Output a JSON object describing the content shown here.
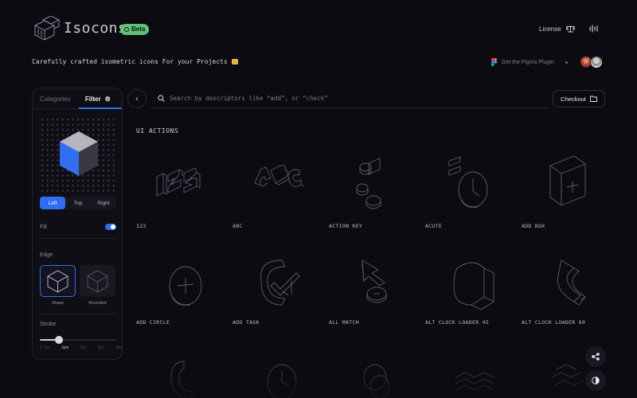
{
  "header": {
    "brand": "Isocons",
    "badge": "Beta",
    "license": "License",
    "tagline": "Carefully crafted isometric icons For your Projects",
    "figma_link": "Get the Figma Plugin"
  },
  "sidebar": {
    "tabs": [
      "Categories",
      "Filter"
    ],
    "active_tab": "Filter",
    "view_options": [
      "Left",
      "Top",
      "Right"
    ],
    "selected_view": "Left",
    "fill_label": "Fill",
    "fill_on": true,
    "edge_label": "Edge",
    "edge_options": [
      "Sharp",
      "Rounded"
    ],
    "selected_edge": "Sharp",
    "stroke_label": "Stroke",
    "stroke_options": [
      "0.5px",
      "1px",
      "2px",
      "3px",
      "4px"
    ],
    "selected_stroke": "1px",
    "accent_color": "#2f6ef0",
    "cube_face_color": "#2f6ef0"
  },
  "toolbar": {
    "search_placeholder": "Search by descriptors like “add”, or “check”",
    "checkout_label": "Checkout"
  },
  "section_title": "UI ACTIONS",
  "icons": [
    {
      "label": "123",
      "icon": "numbers-123-icon"
    },
    {
      "label": "ABC",
      "icon": "letters-abc-icon"
    },
    {
      "label": "ACTION KEY",
      "icon": "action-key-icon"
    },
    {
      "label": "ACUTE",
      "icon": "acute-icon"
    },
    {
      "label": "ADD BOX",
      "icon": "add-box-icon"
    },
    {
      "label": "ADD CIRCLE",
      "icon": "add-circle-icon"
    },
    {
      "label": "ADD TASK",
      "icon": "add-task-icon"
    },
    {
      "label": "ALL MATCH",
      "icon": "all-match-icon"
    },
    {
      "label": "ALT CLOCK LOADER 45",
      "icon": "clock-loader-45-icon"
    },
    {
      "label": "ALT CLOCK LOADER 60",
      "icon": "clock-loader-60-icon"
    }
  ]
}
